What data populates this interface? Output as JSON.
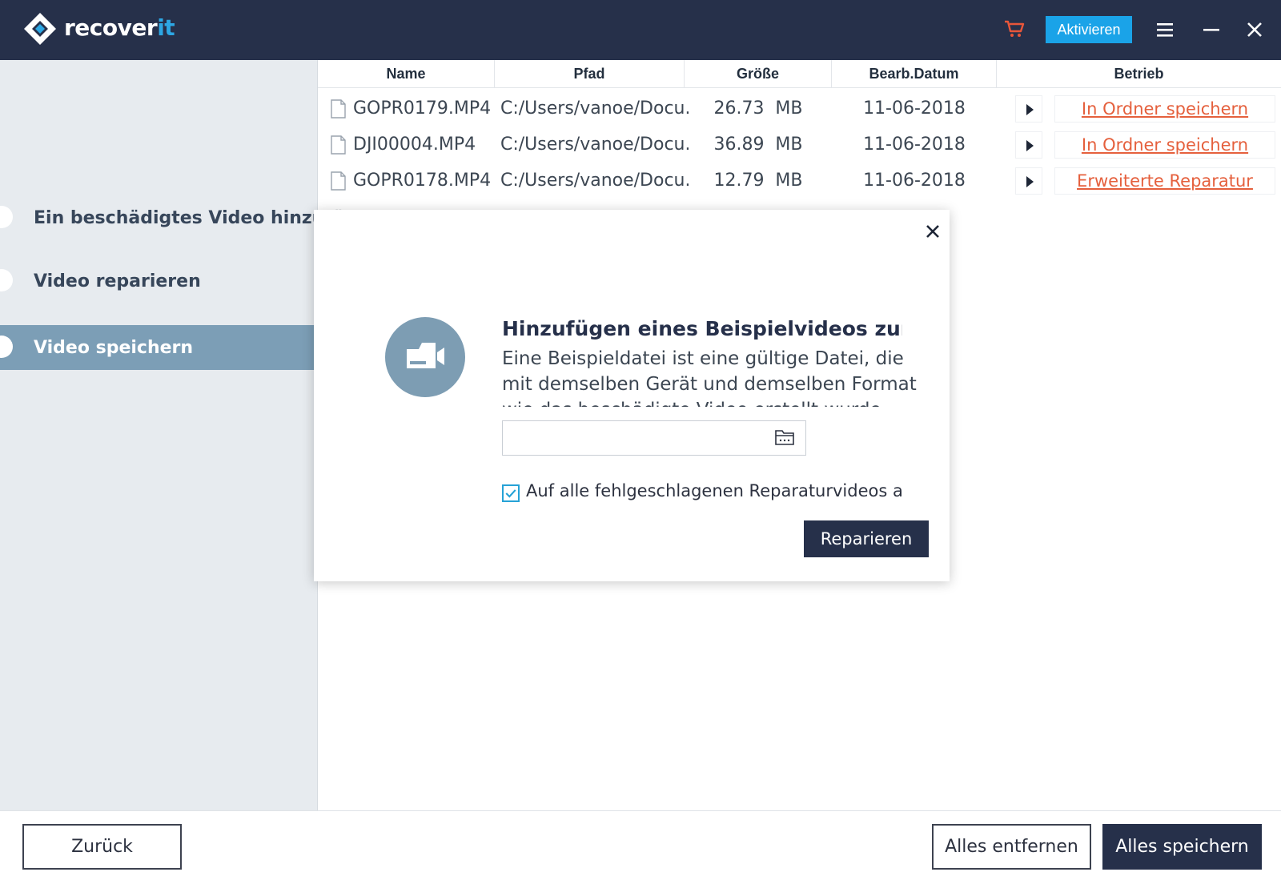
{
  "app": {
    "logo_text_main": "recover",
    "logo_text_accent": "it",
    "activate_label": "Aktivieren",
    "brand_color": "#26304a",
    "accent_color": "#1aa3e8",
    "link_color": "#e5603d"
  },
  "steps": [
    {
      "label": "Ein beschädigtes Video hinzufügen",
      "active": false
    },
    {
      "label": "Video reparieren",
      "active": false
    },
    {
      "label": "Video speichern",
      "active": true
    }
  ],
  "table": {
    "columns": [
      "Name",
      "Pfad",
      "Größe",
      "Bearb.Datum",
      "Betrieb"
    ],
    "rows": [
      {
        "name": "GOPR0179.MP4",
        "path": "C:/Users/vanoe/Docu...",
        "size": "26.73  MB",
        "date": "11-06-2018",
        "action": "In Ordner speichern"
      },
      {
        "name": "DJI00004.MP4",
        "path": "C:/Users/vanoe/Docu...",
        "size": "36.89  MB",
        "date": "11-06-2018",
        "action": "In Ordner speichern"
      },
      {
        "name": "GOPR0178.MP4",
        "path": "C:/Users/vanoe/Docu...",
        "size": "12.79  MB",
        "date": "11-06-2018",
        "action": "Erweiterte Reparatur"
      }
    ]
  },
  "modal": {
    "title": "Hinzufügen eines Beispielvideos zur Reparatur",
    "description": "Eine Beispieldatei ist eine gültige Datei, die mit demselben Gerät und demselben Format wie das beschädigte Video erstellt wurde.",
    "file_value": "",
    "apply_all_label": "Auf alle fehlgeschlagenen Reparaturvideos anwenden",
    "apply_all_checked": true,
    "repair_label": "Reparieren"
  },
  "footer": {
    "back_label": "Zurück",
    "remove_all_label": "Alles entfernen",
    "save_all_label": "Alles speichern"
  }
}
